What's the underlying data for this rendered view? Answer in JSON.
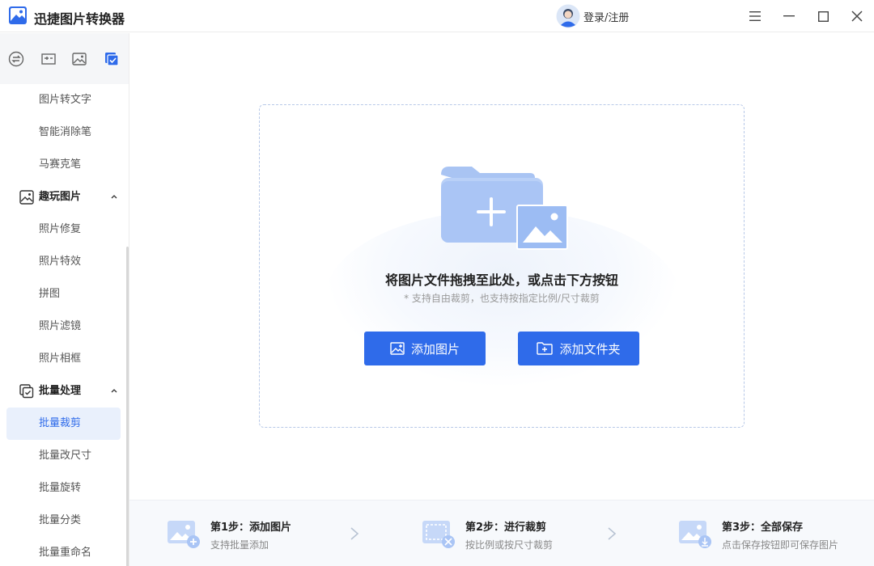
{
  "app": {
    "title": "迅捷图片转换器",
    "accent": "#2f6bea",
    "logo_icon": "mountain-picture-logo"
  },
  "header": {
    "login_label": "登录/注册",
    "avatar_icon": "user-avatar-icon",
    "window_controls": [
      "menu-icon",
      "minimize-icon",
      "maximize-icon",
      "close-icon"
    ]
  },
  "sidebar": {
    "tabs": [
      "convert-icon",
      "edit-icon",
      "image-icon",
      "batch-icon"
    ],
    "active_tab": 3,
    "items": [
      {
        "label": "图片转文字"
      },
      {
        "label": "智能消除笔"
      },
      {
        "label": "马赛克笔"
      }
    ],
    "group_fun": {
      "label": "趣玩图片",
      "icon": "fun-picture-icon",
      "expanded": true
    },
    "fun_items": [
      {
        "label": "照片修复"
      },
      {
        "label": "照片特效"
      },
      {
        "label": "拼图"
      },
      {
        "label": "照片滤镜"
      },
      {
        "label": "照片相框"
      }
    ],
    "group_batch": {
      "label": "批量处理",
      "icon": "batch-check-icon",
      "expanded": true
    },
    "batch_items": [
      {
        "label": "批量裁剪",
        "active": true
      },
      {
        "label": "批量改尺寸"
      },
      {
        "label": "批量旋转"
      },
      {
        "label": "批量分类"
      },
      {
        "label": "批量重命名"
      }
    ]
  },
  "dropzone": {
    "title": "将图片文件拖拽至此处，或点击下方按钮",
    "subtitle": "* 支持自由裁剪，也支持按指定比例/尺寸裁剪",
    "add_image_label": "添加图片",
    "add_folder_label": "添加文件夹"
  },
  "steps": [
    {
      "title": "第1步：添加图片",
      "desc": "支持批量添加",
      "icon": "add-image-step-icon"
    },
    {
      "title": "第2步：进行裁剪",
      "desc": "按比例或按尺寸裁剪",
      "icon": "crop-step-icon"
    },
    {
      "title": "第3步：全部保存",
      "desc": "点击保存按钮即可保存图片",
      "icon": "save-step-icon"
    }
  ]
}
